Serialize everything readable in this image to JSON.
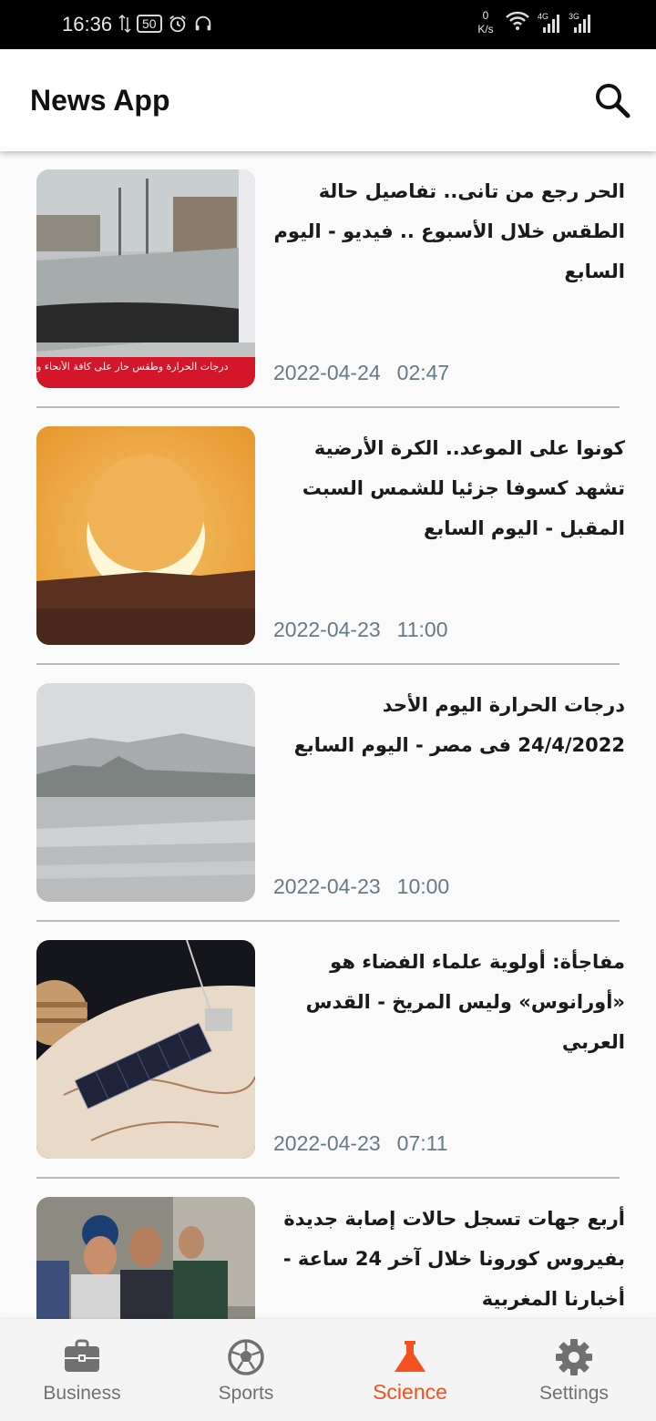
{
  "status_bar": {
    "time": "16:36",
    "battery": "50",
    "net_speed_value": "0",
    "net_speed_unit": "K/s",
    "net_4g": "4G",
    "net_3g": "3G"
  },
  "app_bar": {
    "title": "News App"
  },
  "articles": [
    {
      "title": "الحر رجع من تانى.. تفاصيل حالة الطقس خلال الأسبوع .. فيديو - اليوم السابع",
      "date": "2022-04-24",
      "time": "02:47",
      "caption": "درجات الحرارة وطقس حار على كافة الأنحاء و"
    },
    {
      "title": "كونوا على الموعد.. الكرة الأرضية تشهد كسوفا جزئيا للشمس السبت المقبل - اليوم السابع",
      "date": "2022-04-23",
      "time": "11:00"
    },
    {
      "title": "درجات الحرارة اليوم الأحد 24/4/2022 فى مصر - اليوم السابع",
      "date": "2022-04-23",
      "time": "10:00"
    },
    {
      "title": "مفاجأة: أولوية علماء الفضاء هو «أورانوس» وليس المريخ - القدس العربي",
      "date": "2022-04-23",
      "time": "07:11"
    },
    {
      "title": "أربع جهات تسجل حالات إصابة جديدة بفيروس كورونا خلال آخر 24 ساعة - أخبارنا المغربية",
      "date": "",
      "time": ""
    }
  ],
  "bottom_nav": {
    "items": [
      {
        "label": "Business",
        "icon": "briefcase-icon"
      },
      {
        "label": "Sports",
        "icon": "soccer-ball-icon"
      },
      {
        "label": "Science",
        "icon": "flask-icon"
      },
      {
        "label": "Settings",
        "icon": "gear-icon"
      }
    ],
    "active": "Science",
    "active_color": "#f4511e",
    "inactive_color": "#707070"
  }
}
